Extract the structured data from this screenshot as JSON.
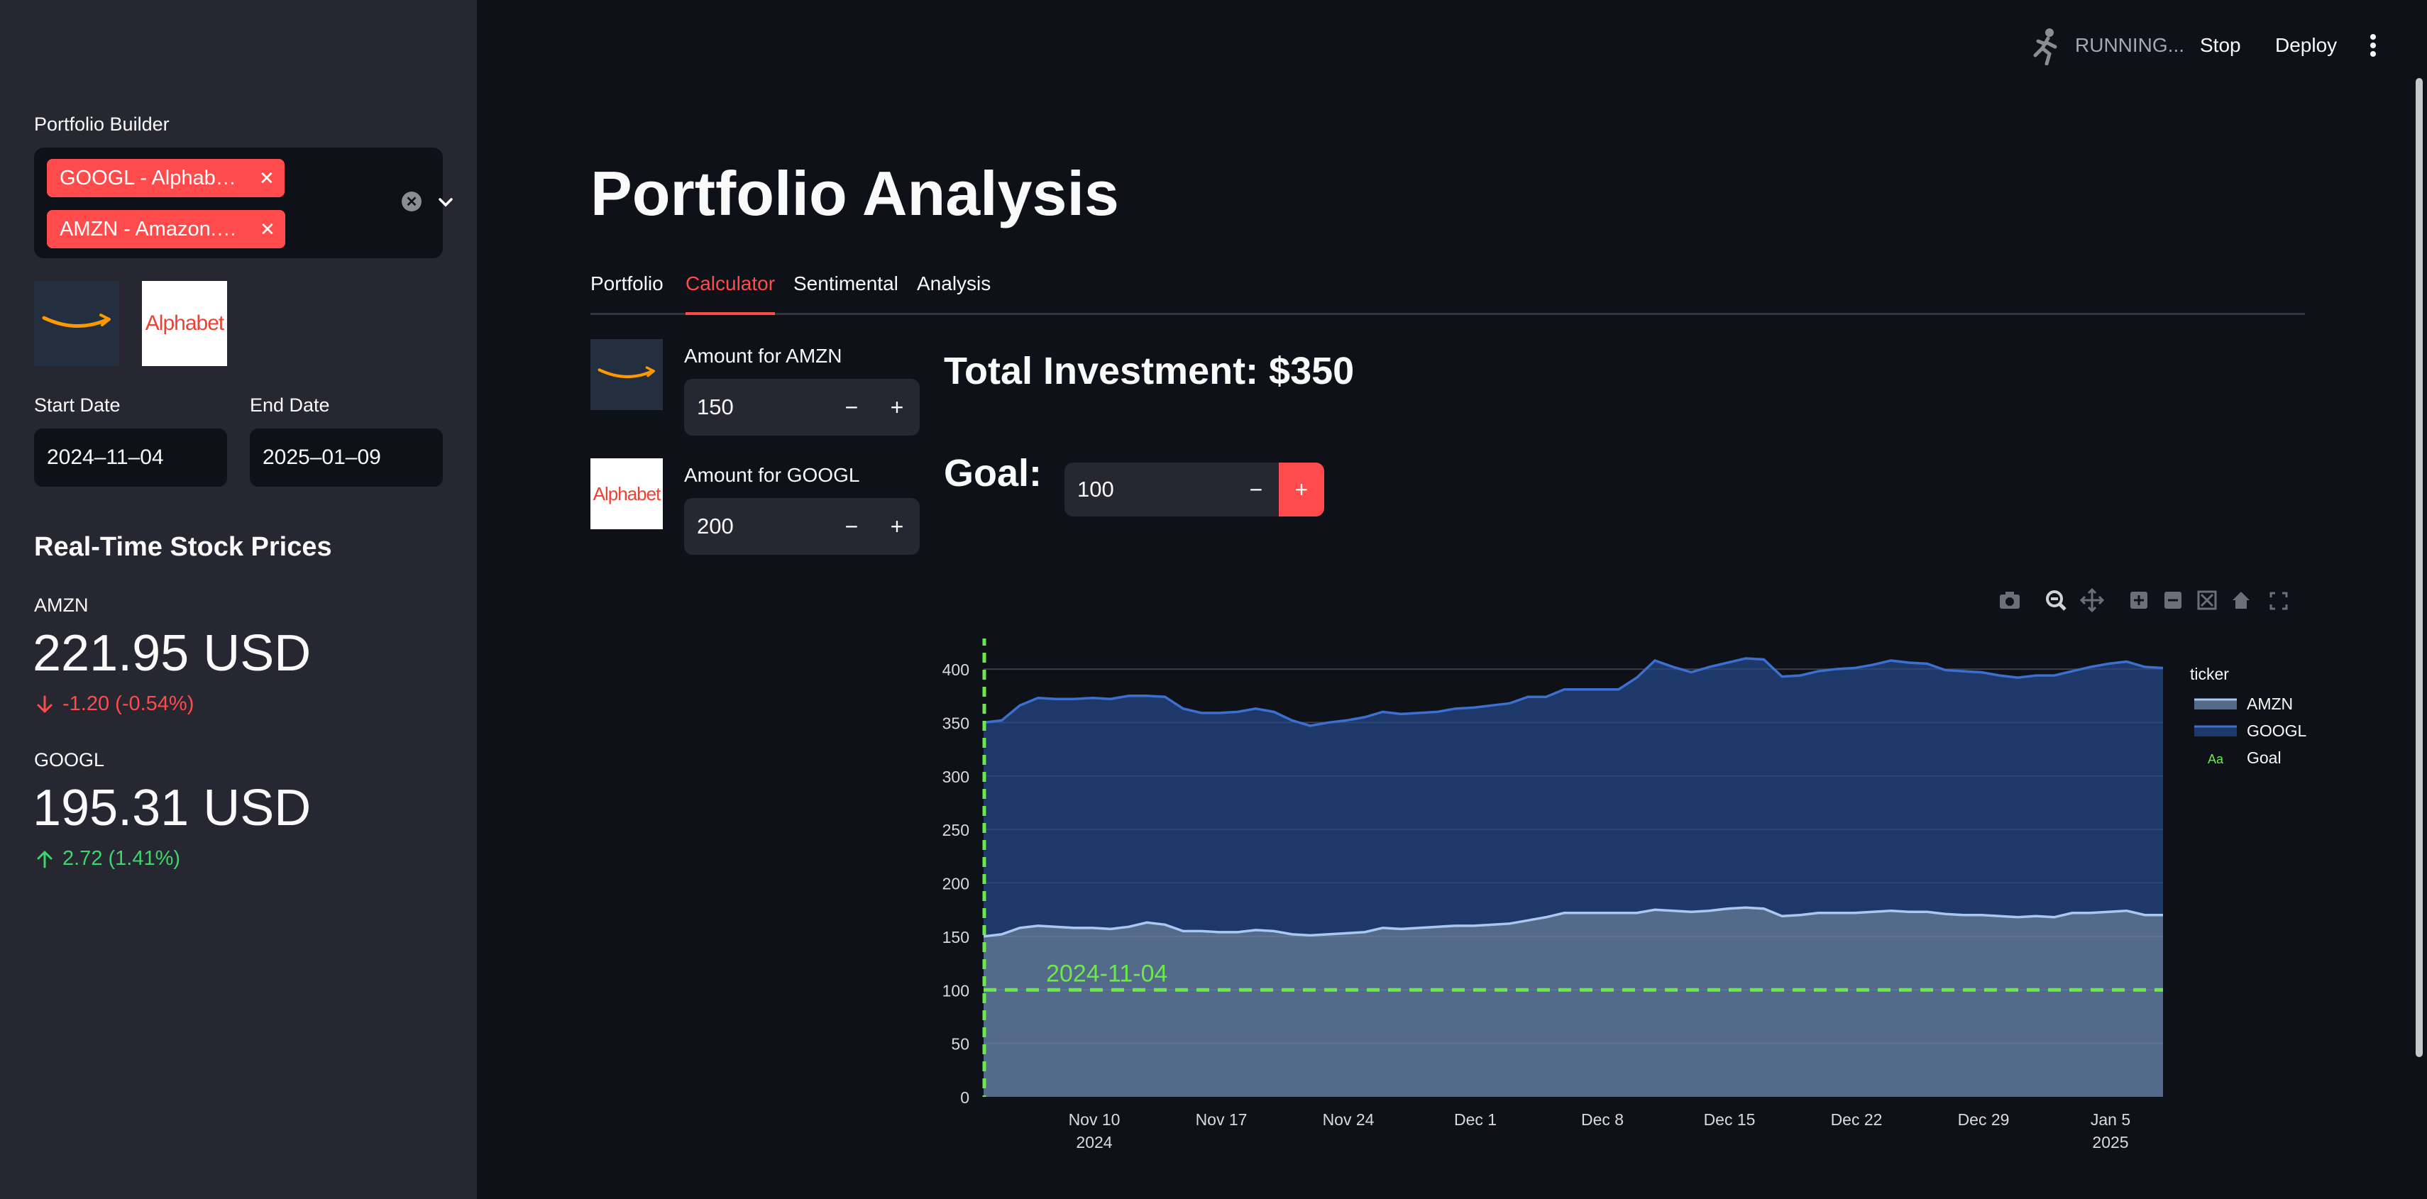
{
  "header": {
    "status": "RUNNING...",
    "stop_label": "Stop",
    "deploy_label": "Deploy"
  },
  "sidebar": {
    "portfolio_label": "Portfolio Builder",
    "selected": [
      {
        "label": "GOOGL - Alphab…"
      },
      {
        "label": "AMZN - Amazon.…"
      }
    ],
    "logos": {
      "amazon": "Amazon",
      "alphabet": "Alphabet"
    },
    "start_date_label": "Start Date",
    "start_date": "2024–11–04",
    "end_date_label": "End Date",
    "end_date": "2025–01–09",
    "prices_title": "Real-Time Stock Prices",
    "metrics": [
      {
        "ticker": "AMZN",
        "value": "221.95 USD",
        "delta": "-1.20 (-0.54%)",
        "direction": "down"
      },
      {
        "ticker": "GOOGL",
        "value": "195.31 USD",
        "delta": "2.72 (1.41%)",
        "direction": "up"
      }
    ]
  },
  "main": {
    "title": "Portfolio Analysis",
    "tabs": [
      {
        "label": "Portfolio",
        "active": false
      },
      {
        "label": "Calculator",
        "active": true
      },
      {
        "label": "Sentimental",
        "active": false
      },
      {
        "label": "Analysis",
        "active": false
      }
    ],
    "amounts": [
      {
        "label": "Amount for AMZN",
        "value": "150"
      },
      {
        "label": "Amount for GOOGL",
        "value": "200"
      }
    ],
    "total_investment": "Total Investment: $350",
    "goal_label": "Goal:",
    "goal_value": "100",
    "minus": "−",
    "plus": "+"
  },
  "colors": {
    "accent": "#ff4b4b",
    "amzn_fill": "#546a8a",
    "googl_fill": "#1e3869",
    "goal_line": "#6de84b",
    "bg": "#0e1117",
    "sidebar_bg": "#262730"
  },
  "chart_data": {
    "type": "area",
    "stacked": true,
    "x_tick_labels": [
      "Nov 10",
      "Nov 17",
      "Nov 24",
      "Dec 1",
      "Dec 8",
      "Dec 15",
      "Dec 22",
      "Dec 29",
      "Jan 5"
    ],
    "x_tick_years": [
      "2024",
      "",
      "",
      "",
      "",
      "",
      "",
      "",
      "2025"
    ],
    "y_ticks": [
      0,
      50,
      100,
      150,
      200,
      250,
      300,
      350,
      400
    ],
    "ylim": [
      0,
      420
    ],
    "legend_title": "ticker",
    "legend": [
      "AMZN",
      "GOOGL",
      "Goal"
    ],
    "legend_position": "right",
    "goal": 100,
    "goal_annotation": "2024-11-04",
    "series": [
      {
        "name": "AMZN",
        "values": [
          150,
          152,
          158,
          160,
          159,
          158,
          158,
          157,
          159,
          163,
          161,
          155,
          155,
          154,
          154,
          156,
          155,
          152,
          151,
          152,
          153,
          154,
          158,
          157,
          158,
          159,
          160,
          160,
          161,
          162,
          165,
          168,
          172,
          172,
          172,
          172,
          172,
          175,
          174,
          173,
          174,
          176,
          177,
          176,
          169,
          170,
          172,
          172,
          172,
          173,
          174,
          173,
          173,
          171,
          170,
          170,
          169,
          168,
          169,
          168,
          172,
          172,
          173,
          174,
          170,
          170
        ]
      },
      {
        "name": "GOOGL",
        "values": [
          200,
          200,
          208,
          213,
          213,
          214,
          215,
          215,
          216,
          212,
          213,
          208,
          204,
          205,
          206,
          207,
          205,
          200,
          196,
          198,
          199,
          201,
          202,
          201,
          201,
          201,
          203,
          204,
          205,
          206,
          209,
          206,
          209,
          209,
          209,
          209,
          220,
          233,
          228,
          224,
          228,
          230,
          233,
          233,
          224,
          224,
          226,
          228,
          229,
          231,
          234,
          233,
          232,
          228,
          228,
          227,
          225,
          224,
          225,
          226,
          226,
          230,
          232,
          233,
          232,
          231
        ]
      }
    ]
  }
}
